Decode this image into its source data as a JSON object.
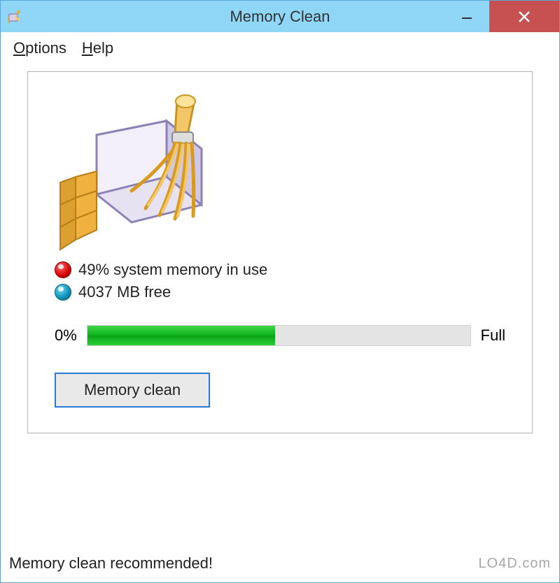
{
  "window": {
    "title": "Memory Clean"
  },
  "menubar": {
    "options": "Options",
    "help": "Help"
  },
  "status": {
    "in_use_label": "49% system memory in use",
    "free_label": "4037 MB free"
  },
  "progress": {
    "left_label": "0%",
    "right_label": "Full",
    "fill_percent": 49
  },
  "button": {
    "clean_label": "Memory clean"
  },
  "statusbar": {
    "message": "Memory clean recommended!",
    "watermark": "LO4D.com"
  }
}
